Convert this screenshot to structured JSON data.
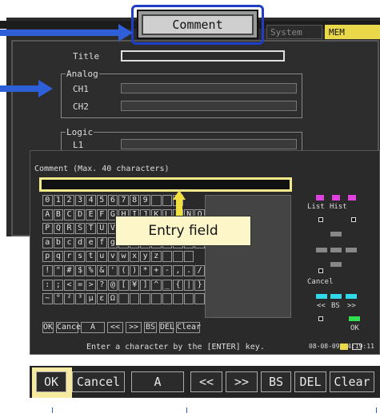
{
  "header": {
    "comment_tab": "Comment",
    "system_tab": "System",
    "mem_tab": "MEM Record"
  },
  "settings": {
    "title_label": "Title",
    "analog_label": "Analog",
    "ch1_label": "CH1",
    "ch2_label": "CH2",
    "logic_label": "Logic",
    "l1_label": "L1"
  },
  "dialog": {
    "title": "Comment (Max. 40 characters)",
    "entry_value": "",
    "hint": "Enter a character by the [ENTER] key.",
    "status": "08-08-09 14:19:11"
  },
  "keyboard": {
    "row1": [
      "0",
      "1",
      "2",
      "3",
      "4",
      "5",
      "6",
      "7",
      "8",
      "9",
      "",
      "",
      ""
    ],
    "row2": [
      "A",
      "B",
      "C",
      "D",
      "E",
      "F",
      "G",
      "H",
      "I",
      "J",
      "K",
      "L",
      "M",
      "N",
      "O"
    ],
    "row3": [
      "P",
      "Q",
      "R",
      "S",
      "T",
      "U",
      "V",
      "W",
      "X",
      "Y",
      "Z",
      "",
      "",
      ""
    ],
    "row4": [
      "a",
      "b",
      "c",
      "d",
      "e",
      "f",
      "g",
      "h",
      "i",
      "j",
      "k",
      "l",
      "m",
      "n",
      "o"
    ],
    "row5": [
      "p",
      "q",
      "r",
      "s",
      "t",
      "u",
      "v",
      "w",
      "x",
      "y",
      "z",
      "",
      "",
      ""
    ],
    "row6": [
      "!",
      "\"",
      "#",
      "$",
      "%",
      "&",
      "'",
      "(",
      ")",
      "*",
      "+",
      "-",
      ",",
      ".",
      "/"
    ],
    "row7": [
      ":",
      ";",
      "<",
      "=",
      ">",
      "?",
      "@",
      "[",
      "¥",
      "]",
      "^",
      "_",
      "{",
      "|",
      "}"
    ],
    "row8": [
      "~",
      "°",
      "²",
      "³",
      "µ",
      "ε",
      "Ω",
      "",
      "",
      "",
      "",
      "",
      "",
      "",
      ""
    ],
    "controls": [
      "OK",
      "Cancel",
      "A",
      "<<",
      ">>",
      "BS",
      "DEL",
      "Clear"
    ]
  },
  "right_panel": {
    "list_label": "List",
    "hist_label": "Hist",
    "cancel_label": "Cancel",
    "prev_label": "<<",
    "bs_label": "BS",
    "next_label": ">>",
    "ok_label": "OK"
  },
  "callout": {
    "label": "Entry field"
  },
  "bottom_bar": {
    "ok": "OK",
    "cancel": "Cancel",
    "mode": "A",
    "prev": "<<",
    "next": ">>",
    "bs": "BS",
    "del": "DEL",
    "clear": "Clear"
  },
  "colors": {
    "highlight_blue": "#1e3ec8",
    "arrow_blue": "#2e5fd8",
    "entry_yellow": "#f1e98a",
    "magenta": "#e040e0",
    "cyan": "#30d8e8",
    "green": "#30e050",
    "mem_yellow": "#e8d84a"
  }
}
